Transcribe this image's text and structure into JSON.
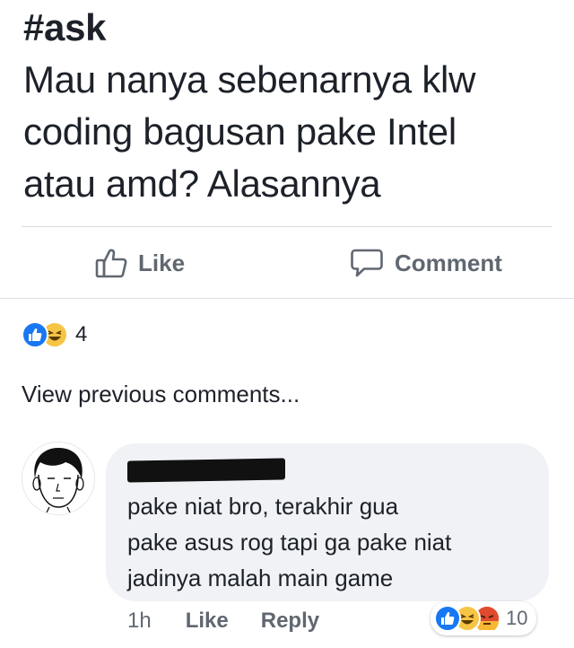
{
  "post": {
    "hashtag": "#ask",
    "lines": [
      "Mau nanya sebenarnya klw",
      "coding bagusan pake Intel",
      "atau amd?  Alasannya"
    ]
  },
  "actions": {
    "like_label": "Like",
    "comment_label": "Comment"
  },
  "reactions": {
    "icons": [
      "like-icon",
      "haha-icon"
    ],
    "count": "4"
  },
  "view_previous": "View previous comments...",
  "comment": {
    "author_redacted": true,
    "lines": [
      "pake niat bro, terakhir gua",
      "pake asus rog tapi ga pake niat",
      "jadinya malah main game"
    ],
    "time": "1h",
    "like_label": "Like",
    "reply_label": "Reply",
    "reactions": {
      "icons": [
        "like-icon",
        "haha-icon",
        "angry-icon"
      ],
      "count": "10"
    }
  },
  "colors": {
    "like_blue": "#1877f2",
    "haha_yellow": "#f7c545",
    "angry_orange": "#e9710f",
    "bubble_gray": "#f0f2f5",
    "meta_gray": "#606770"
  }
}
